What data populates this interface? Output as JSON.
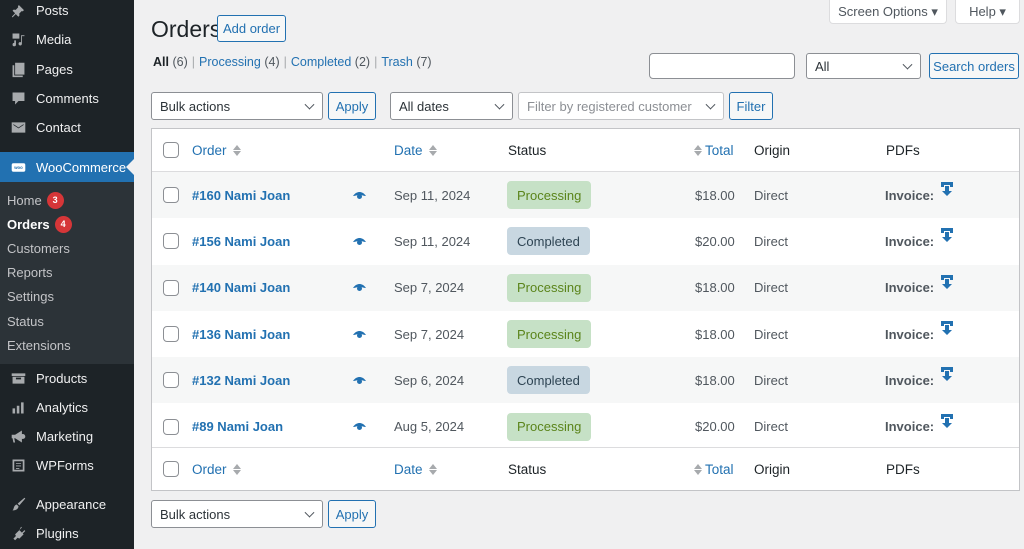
{
  "sidebar": {
    "items": [
      {
        "label": "Posts",
        "icon": "pin-icon"
      },
      {
        "label": "Media",
        "icon": "media-icon"
      },
      {
        "label": "Pages",
        "icon": "pages-icon"
      },
      {
        "label": "Comments",
        "icon": "comment-icon"
      },
      {
        "label": "Contact",
        "icon": "envelope-icon"
      },
      {
        "label": "WooCommerce",
        "icon": "woo-icon",
        "active": true
      },
      {
        "label": "Products",
        "icon": "archive-icon"
      },
      {
        "label": "Analytics",
        "icon": "bar-chart-icon"
      },
      {
        "label": "Marketing",
        "icon": "megaphone-icon"
      },
      {
        "label": "WPForms",
        "icon": "form-icon"
      },
      {
        "label": "Appearance",
        "icon": "paintbrush-icon"
      },
      {
        "label": "Plugins",
        "icon": "plug-icon"
      }
    ],
    "submenu": [
      {
        "label": "Home",
        "badge": "3"
      },
      {
        "label": "Orders",
        "badge": "4",
        "current": true
      },
      {
        "label": "Customers"
      },
      {
        "label": "Reports"
      },
      {
        "label": "Settings"
      },
      {
        "label": "Status"
      },
      {
        "label": "Extensions"
      }
    ]
  },
  "header": {
    "title": "Orders",
    "add_order_label": "Add order",
    "screen_options_label": "Screen Options ▾",
    "help_label": "Help ▾"
  },
  "views": [
    {
      "label": "All",
      "count": "(6)",
      "current": true
    },
    {
      "label": "Processing",
      "count": "(4)"
    },
    {
      "label": "Completed",
      "count": "(2)"
    },
    {
      "label": "Trash",
      "count": "(7)"
    }
  ],
  "search": {
    "value": "",
    "type_select": "All",
    "button_label": "Search orders"
  },
  "filters": {
    "bulk_actions": "Bulk actions",
    "apply_label": "Apply",
    "dates": "All dates",
    "customer_placeholder": "Filter by registered customer",
    "filter_label": "Filter"
  },
  "table": {
    "columns": {
      "order": "Order",
      "date": "Date",
      "status": "Status",
      "total": "Total",
      "origin": "Origin",
      "pdfs": "PDFs"
    },
    "rows": [
      {
        "order": "#160 Nami Joan",
        "date": "Sep 11, 2024",
        "status": "Processing",
        "status_key": "processing",
        "total": "$18.00",
        "origin": "Direct",
        "pdf": "Invoice:"
      },
      {
        "order": "#156 Nami Joan",
        "date": "Sep 11, 2024",
        "status": "Completed",
        "status_key": "completed",
        "total": "$20.00",
        "origin": "Direct",
        "pdf": "Invoice:"
      },
      {
        "order": "#140 Nami Joan",
        "date": "Sep 7, 2024",
        "status": "Processing",
        "status_key": "processing",
        "total": "$18.00",
        "origin": "Direct",
        "pdf": "Invoice:"
      },
      {
        "order": "#136 Nami Joan",
        "date": "Sep 7, 2024",
        "status": "Processing",
        "status_key": "processing",
        "total": "$18.00",
        "origin": "Direct",
        "pdf": "Invoice:"
      },
      {
        "order": "#132 Nami Joan",
        "date": "Sep 6, 2024",
        "status": "Completed",
        "status_key": "completed",
        "total": "$18.00",
        "origin": "Direct",
        "pdf": "Invoice:"
      },
      {
        "order": "#89 Nami Joan",
        "date": "Aug 5, 2024",
        "status": "Processing",
        "status_key": "processing",
        "total": "$20.00",
        "origin": "Direct",
        "pdf": "Invoice:"
      }
    ]
  },
  "bottom": {
    "bulk_actions": "Bulk actions",
    "apply_label": "Apply"
  },
  "colors": {
    "accent": "#2271b1",
    "sidebar_bg": "#1d2327",
    "processing_bg": "#c6e1c6",
    "completed_bg": "#c8d7e1"
  }
}
